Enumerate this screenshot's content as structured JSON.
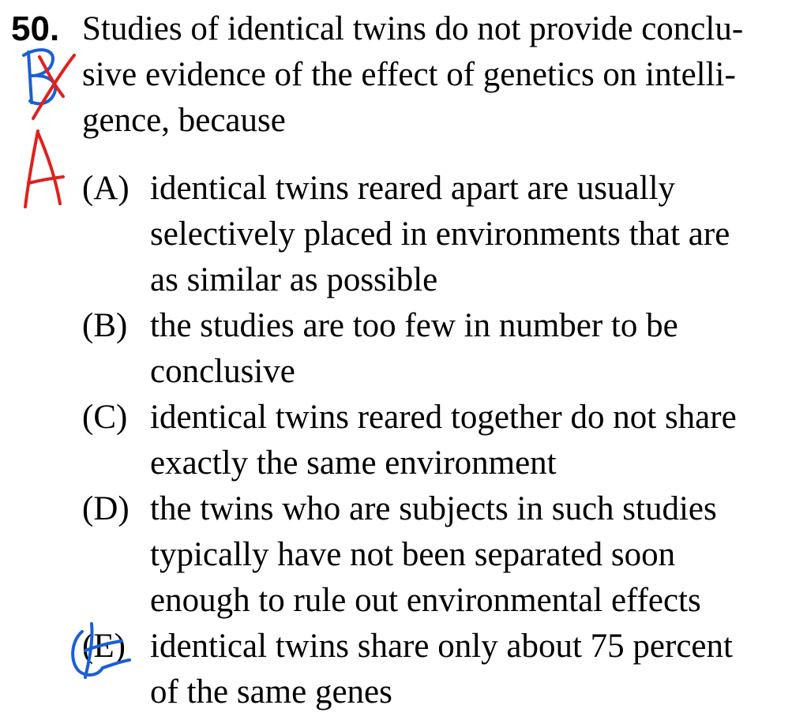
{
  "question": {
    "number": "50.",
    "stem_lines": [
      "Studies of identical twins do not provide conclu-",
      "sive evidence of the effect of genetics on intelli-",
      "gence, because"
    ]
  },
  "choices": [
    {
      "letter": "(A)",
      "lines": [
        "identical twins reared apart are usually",
        "selectively placed in environments that are",
        "as similar as possible"
      ]
    },
    {
      "letter": "(B)",
      "lines": [
        "the studies are too few in number to be",
        "conclusive"
      ]
    },
    {
      "letter": "(C)",
      "lines": [
        "identical twins reared together do not share",
        "exactly the same environment"
      ]
    },
    {
      "letter": "(D)",
      "lines": [
        "the twins who are subjects in such studies",
        "typically have not been separated soon",
        "enough to rule out environmental effects"
      ]
    },
    {
      "letter": "(E)",
      "lines": [
        "identical twins share only about 75 percent",
        "of the same genes"
      ]
    }
  ],
  "annotations": {
    "blue_ink_color": "#1a5fd6",
    "red_ink_color": "#e0201c",
    "handwritten_marks": [
      "B",
      "A"
    ]
  }
}
